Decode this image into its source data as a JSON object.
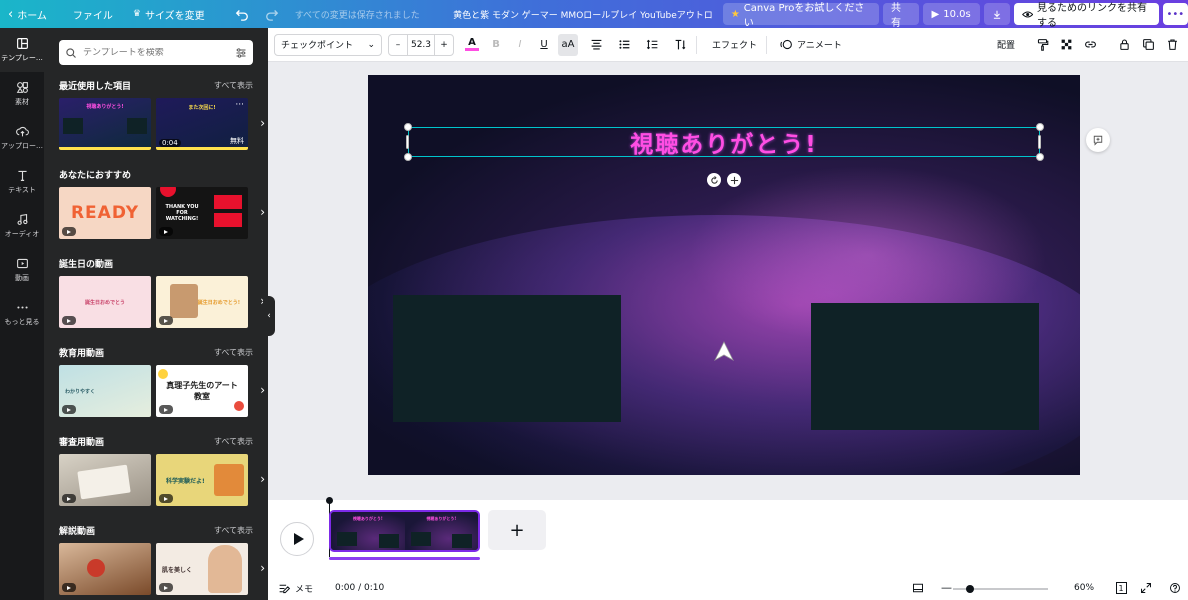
{
  "topbar": {
    "home": "ホーム",
    "file": "ファイル",
    "resize": "サイズを変更",
    "save_status": "すべての変更は保存されました",
    "doc_title": "黄色と紫 モダン ゲーマー MMOロールプレイ YouTubeアウトロ",
    "try_pro": "Canva Proをお試しください",
    "share": "共有",
    "play_duration": "10.0s",
    "share_link": "見るためのリンクを共有する",
    "more": "•••"
  },
  "rail": {
    "items": [
      {
        "label": "テンプレー…",
        "icon": "template-icon"
      },
      {
        "label": "素材",
        "icon": "elements-icon"
      },
      {
        "label": "アップロー…",
        "icon": "upload-icon"
      },
      {
        "label": "テキスト",
        "icon": "text-icon"
      },
      {
        "label": "オーディオ",
        "icon": "audio-icon"
      },
      {
        "label": "動画",
        "icon": "video-icon"
      },
      {
        "label": "もっと見る",
        "icon": "more-icon"
      }
    ]
  },
  "panel": {
    "search_placeholder": "テンプレートを検索",
    "see_all": "すべて表示",
    "sections": [
      {
        "title": "最近使用した項目",
        "thumb1_text": "視聴ありがとう!",
        "thumb2_text": "また次回に!",
        "thumb2_dur": "0:04",
        "thumb2_badge": "無料"
      },
      {
        "title": "あなたにおすすめ",
        "thumb1_text": "READY",
        "thumb2_text": "THANK YOU FOR WATCHING!"
      },
      {
        "title": "誕生日の動画",
        "thumb1_text": "誕生日おめでとう",
        "thumb2_text": "お誕生日おめでとう!"
      },
      {
        "title": "教育用動画",
        "thumb1_text": "わかりやすく",
        "thumb2_text": "真理子先生のアート教室"
      },
      {
        "title": "審査用動画",
        "thumb1_text": "",
        "thumb2_text": "科学実験だよ!"
      },
      {
        "title": "解説動画",
        "thumb1_text": "",
        "thumb2_text": "肌を美しく"
      }
    ]
  },
  "toolbar": {
    "font": "チェックポイント",
    "minus": "–",
    "size": "52.3",
    "plus": "+",
    "text_color_glyph": "A",
    "bold": "B",
    "italic": "I",
    "underline": "U",
    "case": "aA",
    "effects": "エフェクト",
    "animate": "アニメート",
    "position": "配置"
  },
  "canvas": {
    "title_text": "視聴ありがとう!"
  },
  "timeline": {
    "clip_text": "視聴ありがとう!",
    "add": "+"
  },
  "status": {
    "memo": "メモ",
    "timecode": "0:00 / 0:10",
    "zoom": "60%",
    "zoom_fraction": 0.18,
    "page_count": "1"
  },
  "colors": {
    "accent": "#7d2ae8",
    "title_pink": "#ff4ee3",
    "selection": "#00c4cc"
  }
}
